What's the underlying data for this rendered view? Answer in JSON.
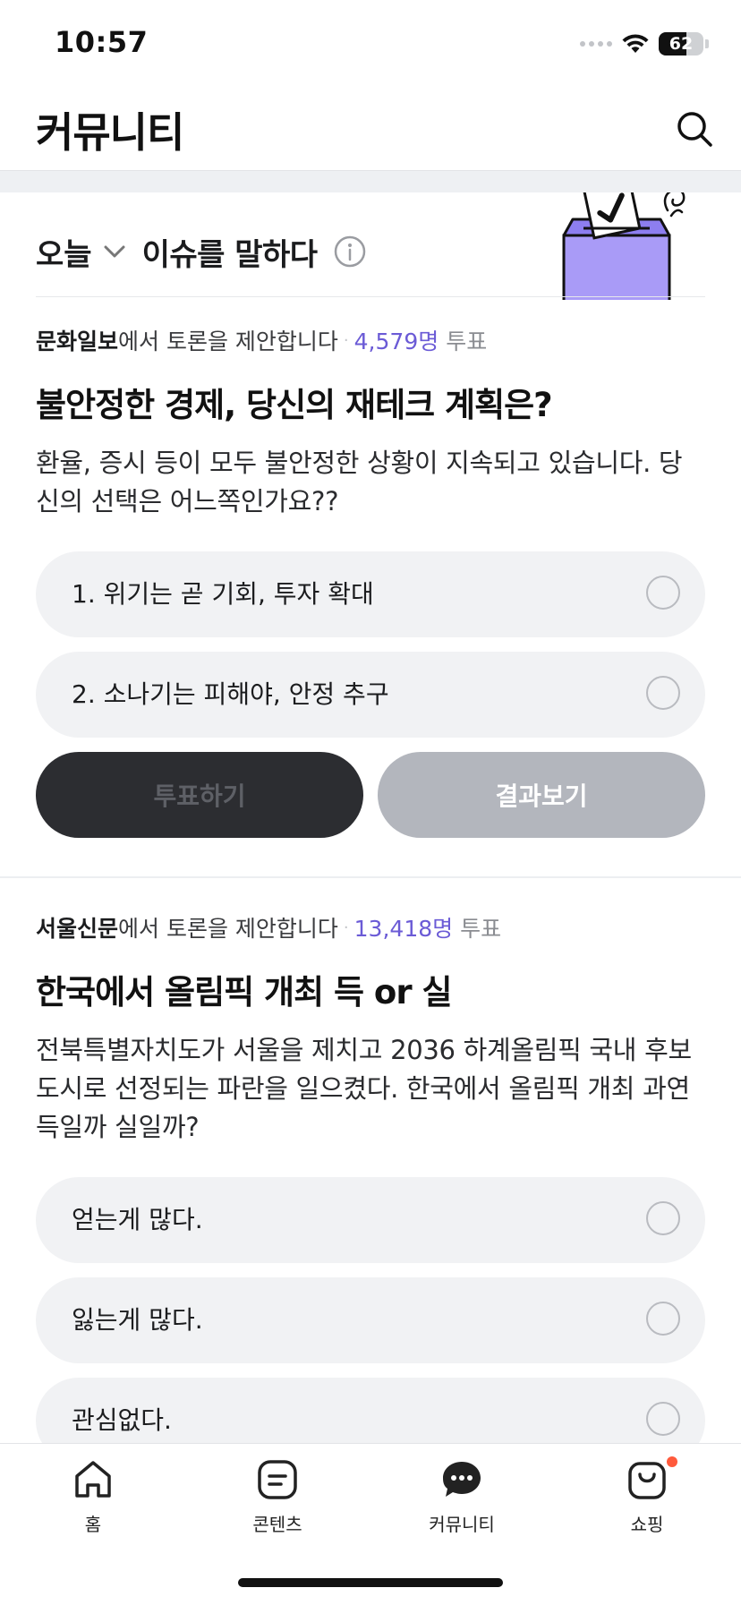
{
  "status_bar": {
    "time": "10:57",
    "battery": "62",
    "battery_level": 0.62
  },
  "header": {
    "title": "커뮤니티",
    "search_icon": "search-icon"
  },
  "section": {
    "today_label": "오늘",
    "title": "이슈를 말하다",
    "info_icon": "info-icon",
    "illustration": "ballot-box-illustration"
  },
  "polls": [
    {
      "source": "문화일보",
      "source_suffix": "에서 토론을 제안합니다",
      "separator": "·",
      "vote_count": "4,579명",
      "vote_word": "투표",
      "question": "불안정한 경제, 당신의 재테크 계획은?",
      "description": "환율, 증시 등이 모두 불안정한 상황이 지속되고 있습니다. 당신의 선택은 어느쪽인가요??",
      "options": [
        "1. 위기는 곧 기회, 투자 확대",
        "2. 소나기는 피해야, 안정 추구"
      ],
      "vote_button": "투표하기",
      "result_button": "결과보기"
    },
    {
      "source": "서울신문",
      "source_suffix": "에서 토론을 제안합니다",
      "separator": "·",
      "vote_count": "13,418명",
      "vote_word": "투표",
      "question": "한국에서 올림픽 개최 득 or 실",
      "description": "전북특별자치도가 서울을 제치고 2036 하계올림픽 국내 후보도시로 선정되는 파란을 일으켰다. 한국에서 올림픽 개최 과연 득일까 실일까?",
      "options": [
        "얻는게 많다.",
        "잃는게 많다.",
        "관심없다."
      ]
    }
  ],
  "bottom_nav": [
    {
      "label": "홈",
      "icon": "home-icon"
    },
    {
      "label": "콘텐츠",
      "icon": "contents-icon"
    },
    {
      "label": "커뮤니티",
      "icon": "community-chat-icon",
      "active": true
    },
    {
      "label": "쇼핑",
      "icon": "shopping-bag-icon",
      "badge": true
    }
  ],
  "colors": {
    "accent": "#6b5bd6",
    "vote_button": "#2c2d31",
    "result_button": "#b3b6bd",
    "badge": "#ff5a3c",
    "illustration": "#a99bf7"
  }
}
